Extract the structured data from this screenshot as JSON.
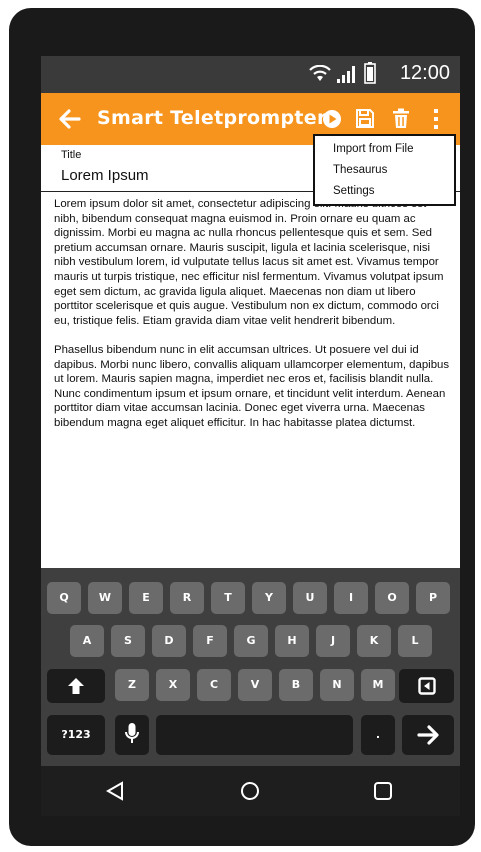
{
  "status": {
    "time": "12:00"
  },
  "app": {
    "title": "Smart Teletprompter"
  },
  "field": {
    "label": "Title",
    "value": "Lorem Ipsum"
  },
  "menu": {
    "items": [
      "Import from File",
      "Thesaurus",
      "Settings"
    ]
  },
  "content": {
    "paragraphs": [
      "Lorem ipsum dolor sit amet, consectetur adipiscing elit. Mauris ultrices est nibh, bibendum consequat magna euismod in. Proin ornare eu quam ac dignissim. Morbi eu magna ac nulla rhoncus pellentesque quis et sem. Sed pretium accumsan ornare. Mauris suscipit, ligula et lacinia scelerisque, nisi nibh vestibulum lorem, id vulputate tellus lacus sit amet est. Vivamus tempor mauris ut turpis tristique, nec efficitur nisl fermentum. Vivamus volutpat ipsum eget sem dictum, ac gravida ligula aliquet. Maecenas non diam ut libero porttitor scelerisque et quis augue. Vestibulum non ex dictum, commodo orci eu, tristique felis. Etiam gravida diam vitae velit hendrerit bibendum.",
      "Phasellus bibendum nunc in elit accumsan ultrices. Ut posuere vel dui id dapibus. Morbi nunc libero, convallis aliquam ullamcorper elementum, dapibus ut lorem. Mauris sapien magna, imperdiet nec eros et, facilisis blandit nulla. Nunc condimentum ipsum et ipsum ornare, et tincidunt velit interdum. Aenean porttitor diam vitae accumsan lacinia. Donec eget viverra urna. Maecenas bibendum magna eget aliquet efficitur. In hac habitasse platea dictumst."
    ]
  },
  "keyboard": {
    "row1": [
      "Q",
      "W",
      "E",
      "R",
      "T",
      "Y",
      "U",
      "I",
      "O",
      "P"
    ],
    "row2": [
      "A",
      "S",
      "D",
      "F",
      "G",
      "H",
      "J",
      "K",
      "L"
    ],
    "row3": [
      "Z",
      "X",
      "C",
      "V",
      "B",
      "N",
      "M"
    ],
    "symbols_label": "?123",
    "period_label": "."
  },
  "icons": {
    "back": "arrow-left-icon",
    "play": "play-icon",
    "save": "save-icon",
    "delete": "trash-icon",
    "more": "more-vert-icon",
    "wifi": "wifi-icon",
    "signal": "signal-icon",
    "battery": "battery-icon",
    "shift": "shift-arrow-icon",
    "backspace": "backspace-icon",
    "mic": "mic-icon",
    "enter": "arrow-right-icon",
    "nav_back": "triangle-back-icon",
    "nav_home": "circle-home-icon",
    "nav_recent": "square-recent-icon"
  },
  "colors": {
    "accent": "#f7941d",
    "status_bar": "#3a3a3a",
    "keyboard_bg": "#3f3f3f",
    "key": "#6b6b6b"
  }
}
